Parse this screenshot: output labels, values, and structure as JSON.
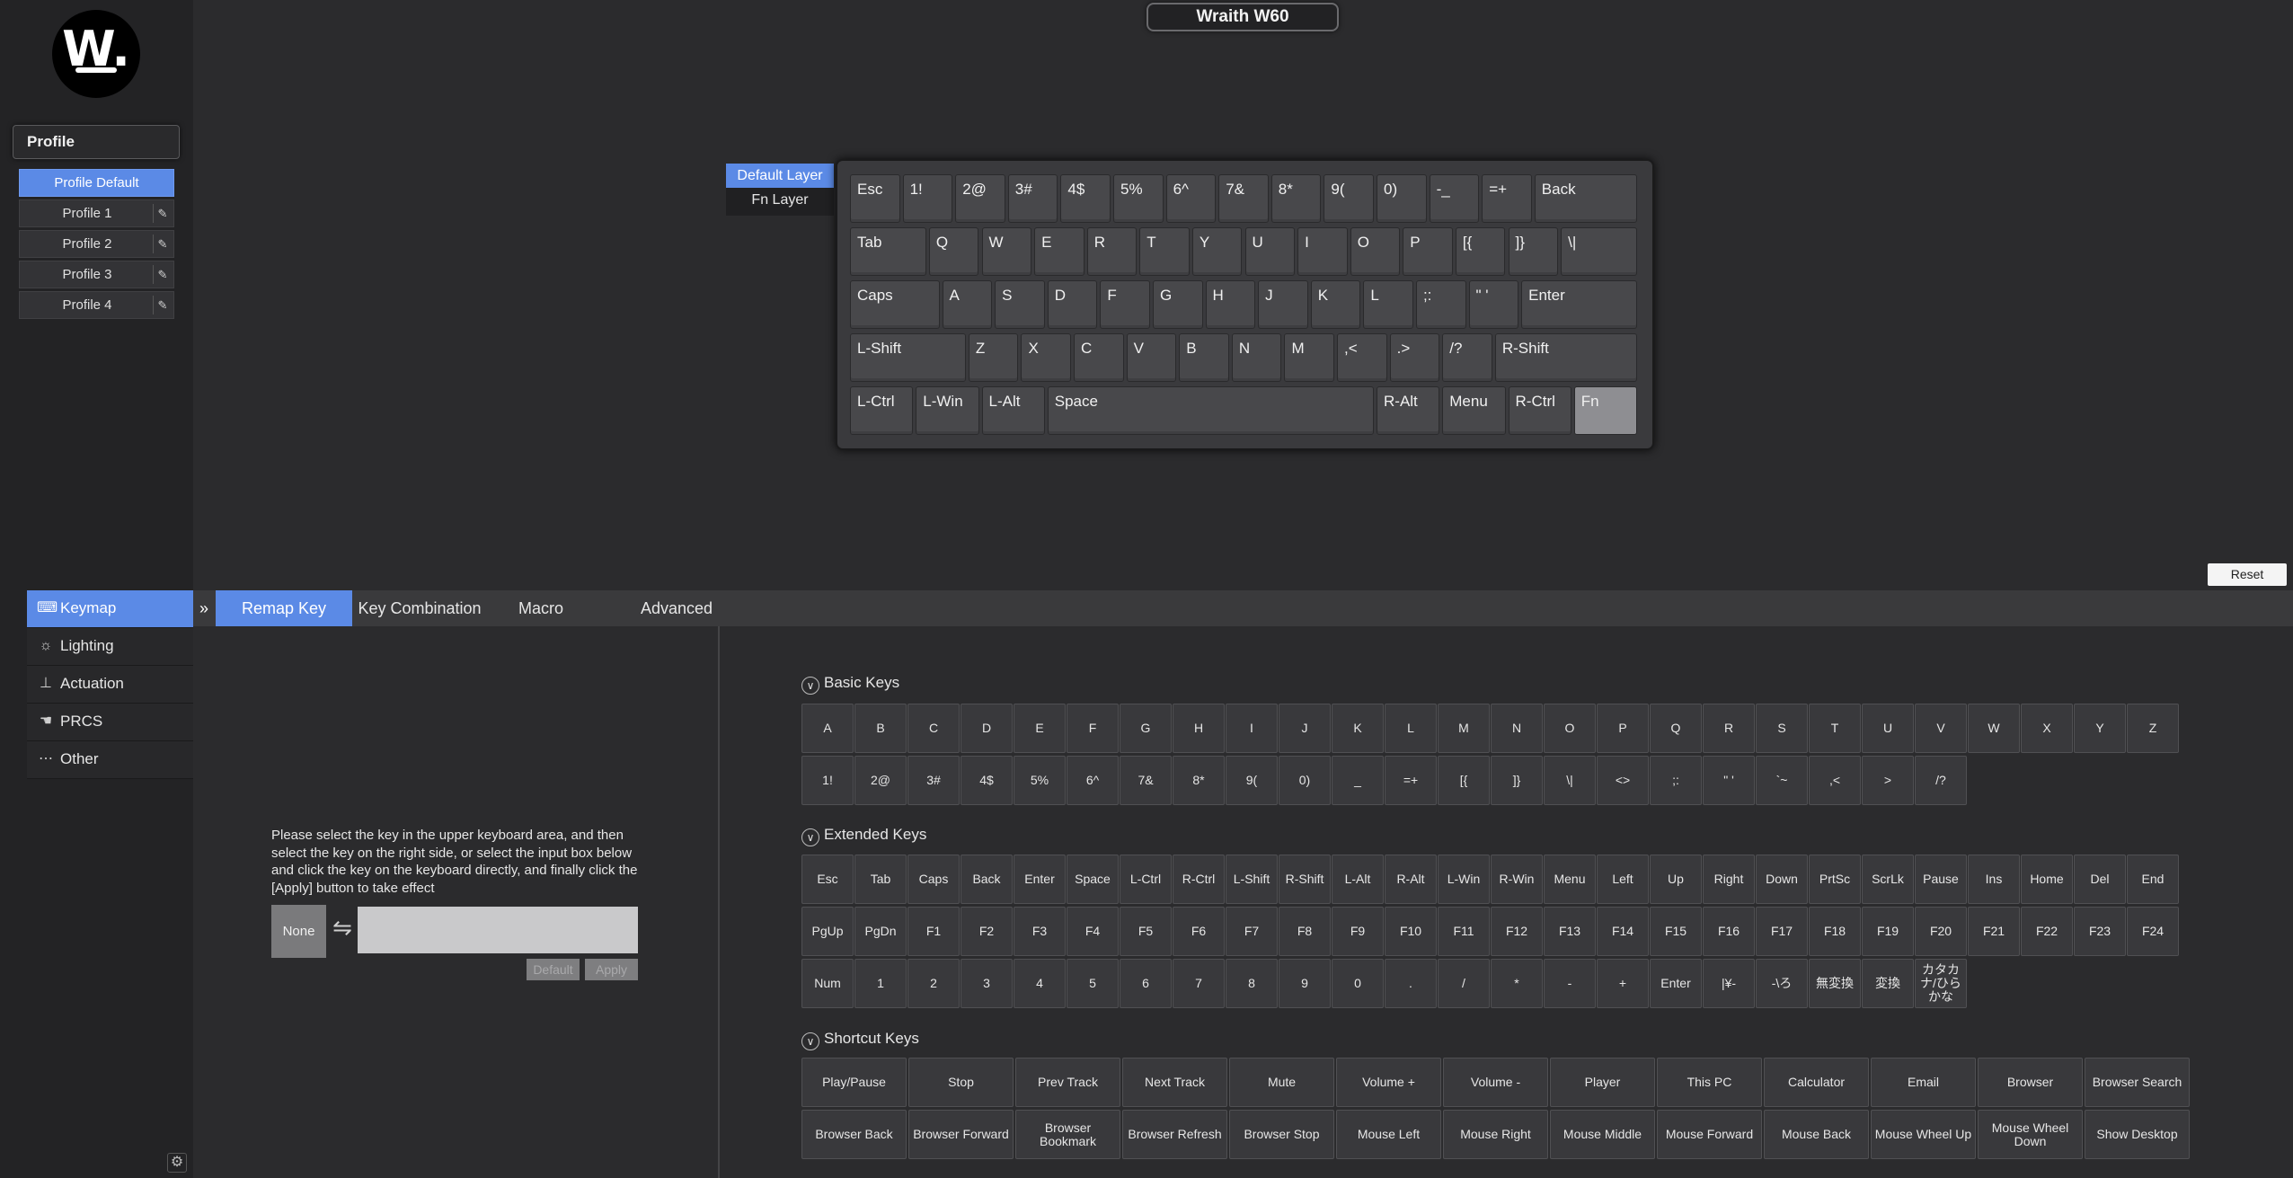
{
  "device": {
    "title": "Wraith W60"
  },
  "logo": {
    "text": "W."
  },
  "sidebar": {
    "profile_header": "Profile",
    "profiles": [
      {
        "label": "Profile Default",
        "active": true
      },
      {
        "label": "Profile 1"
      },
      {
        "label": "Profile 2"
      },
      {
        "label": "Profile 3"
      },
      {
        "label": "Profile 4"
      }
    ],
    "nav": [
      {
        "label": "Keymap",
        "icon": "keyboard-icon",
        "active": true
      },
      {
        "label": "Lighting",
        "icon": "lightbulb-icon"
      },
      {
        "label": "Actuation",
        "icon": "actuation-icon"
      },
      {
        "label": "PRCS",
        "icon": "hand-icon"
      },
      {
        "label": "Other",
        "icon": "dots-icon"
      }
    ]
  },
  "layers": [
    "Default Layer",
    "Fn Layer"
  ],
  "keyboard": {
    "rows": [
      [
        "Esc",
        "1!",
        "2@",
        "3#",
        "4$",
        "5%",
        "6^",
        "7&",
        "8*",
        "9(",
        "0)",
        "-_",
        "=+",
        "Back"
      ],
      [
        "Tab",
        "Q",
        "W",
        "E",
        "R",
        "T",
        "Y",
        "U",
        "I",
        "O",
        "P",
        "[{",
        "]}",
        "\\|"
      ],
      [
        "Caps",
        "A",
        "S",
        "D",
        "F",
        "G",
        "H",
        "J",
        "K",
        "L",
        ";:",
        "\" '",
        "Enter"
      ],
      [
        "L-Shift",
        "Z",
        "X",
        "C",
        "V",
        "B",
        "N",
        "M",
        ",<",
        ".>",
        "/?",
        "R-Shift"
      ],
      [
        "L-Ctrl",
        "L-Win",
        "L-Alt",
        "Space",
        "R-Alt",
        "Menu",
        "R-Ctrl",
        "Fn"
      ]
    ],
    "selected_key": "Fn"
  },
  "reset_label": "Reset",
  "tabs": [
    "Remap Key",
    "Key Combination",
    "Macro",
    "Advanced"
  ],
  "remap": {
    "instructions": "Please select the key in the upper keyboard area, and then select the key on the right side, or select the input box below and click the key on the keyboard directly, and finally click the [Apply] button to take effect",
    "none_label": "None",
    "default_label": "Default",
    "apply_label": "Apply"
  },
  "sections": {
    "basic": {
      "title": "Basic Keys",
      "rows": [
        [
          "A",
          "B",
          "C",
          "D",
          "E",
          "F",
          "G",
          "H",
          "I",
          "J",
          "K",
          "L",
          "M",
          "N",
          "O",
          "P",
          "Q",
          "R",
          "S",
          "T",
          "U",
          "V",
          "W",
          "X",
          "Y",
          "Z"
        ],
        [
          "1!",
          "2@",
          "3#",
          "4$",
          "5%",
          "6^",
          "7&",
          "8*",
          "9(",
          "0)",
          "_",
          "=+",
          "[{",
          "]}",
          "\\|",
          "<>",
          ";:",
          "\" '",
          "`~",
          ",<",
          ">",
          "/?"
        ]
      ]
    },
    "extended": {
      "title": "Extended Keys",
      "rows": [
        [
          "Esc",
          "Tab",
          "Caps",
          "Back",
          "Enter",
          "Space",
          "L-Ctrl",
          "R-Ctrl",
          "L-Shift",
          "R-Shift",
          "L-Alt",
          "R-Alt",
          "L-Win",
          "R-Win",
          "Menu",
          "Left",
          "Up",
          "Right",
          "Down",
          "PrtSc",
          "ScrLk",
          "Pause",
          "Ins",
          "Home",
          "Del",
          "End"
        ],
        [
          "PgUp",
          "PgDn",
          "F1",
          "F2",
          "F3",
          "F4",
          "F5",
          "F6",
          "F7",
          "F8",
          "F9",
          "F10",
          "F11",
          "F12",
          "F13",
          "F14",
          "F15",
          "F16",
          "F17",
          "F18",
          "F19",
          "F20",
          "F21",
          "F22",
          "F23",
          "F24"
        ],
        [
          "Num",
          "1",
          "2",
          "3",
          "4",
          "5",
          "6",
          "7",
          "8",
          "9",
          "0",
          ".",
          "/",
          "*",
          "-",
          "+",
          "Enter",
          "|¥-",
          "-\\ろ",
          "無変換",
          "変換",
          "カタカナ/ひらかな"
        ]
      ]
    },
    "shortcut": {
      "title": "Shortcut Keys",
      "rows": [
        [
          "Play/Pause",
          "Stop",
          "Prev Track",
          "Next Track",
          "Mute",
          "Volume +",
          "Volume -",
          "Player",
          "This PC",
          "Calculator",
          "Email",
          "Browser",
          "Browser Search"
        ],
        [
          "Browser Back",
          "Browser Forward",
          "Browser Bookmark",
          "Browser Refresh",
          "Browser Stop",
          "Mouse Left",
          "Mouse Right",
          "Mouse Middle",
          "Mouse Forward",
          "Mouse Back",
          "Mouse Wheel Up",
          "Mouse Wheel Down",
          "Show Desktop"
        ]
      ]
    }
  },
  "colors": {
    "accent": "#5b8ae6",
    "background": "#2b2b2d",
    "sidebar": "#232325"
  }
}
